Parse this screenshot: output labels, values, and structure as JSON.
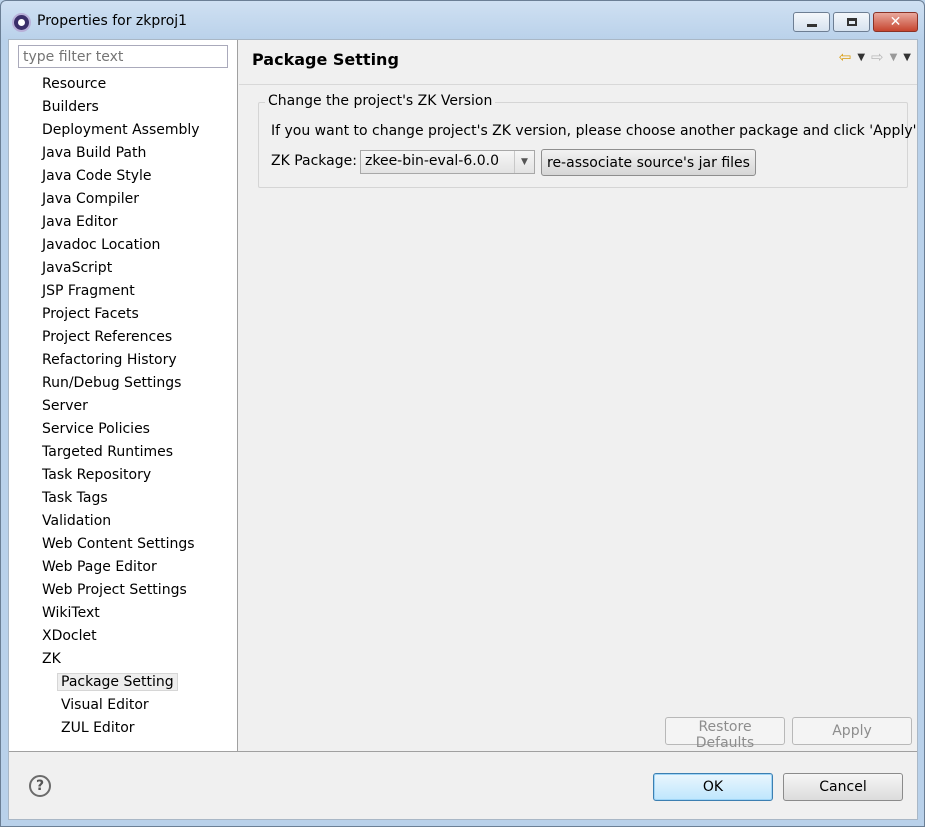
{
  "window": {
    "title": "Properties for zkproj1"
  },
  "filter": {
    "placeholder": "type filter text"
  },
  "tree": {
    "items": [
      "Resource",
      "Builders",
      "Deployment Assembly",
      "Java Build Path",
      "Java Code Style",
      "Java Compiler",
      "Java Editor",
      "Javadoc Location",
      "JavaScript",
      "JSP Fragment",
      "Project Facets",
      "Project References",
      "Refactoring History",
      "Run/Debug Settings",
      "Server",
      "Service Policies",
      "Targeted Runtimes",
      "Task Repository",
      "Task Tags",
      "Validation",
      "Web Content Settings",
      "Web Page Editor",
      "Web Project Settings",
      "WikiText",
      "XDoclet",
      "ZK"
    ],
    "zk_children": [
      "Package Setting",
      "Visual Editor",
      "ZUL Editor"
    ],
    "selected": "Package Setting"
  },
  "page": {
    "title": "Package Setting",
    "group_title": "Change the project's ZK Version",
    "description": "If you want to change project's ZK version, please choose another package and click 'Apply'",
    "package_label": "ZK Package:",
    "package_value": "zkee-bin-eval-6.0.0",
    "reassociate_label": "re-associate source's jar files",
    "restore_label": "Restore Defaults",
    "apply_label": "Apply"
  },
  "buttons": {
    "ok": "OK",
    "cancel": "Cancel",
    "help": "?"
  },
  "icons": {
    "back": "back-arrow-icon",
    "forward": "forward-arrow-icon",
    "menu": "view-menu-icon"
  },
  "colors": {
    "accent": "#3c7fb1",
    "selection": "#eeeeee",
    "back_arrow": "#d89a0a"
  }
}
